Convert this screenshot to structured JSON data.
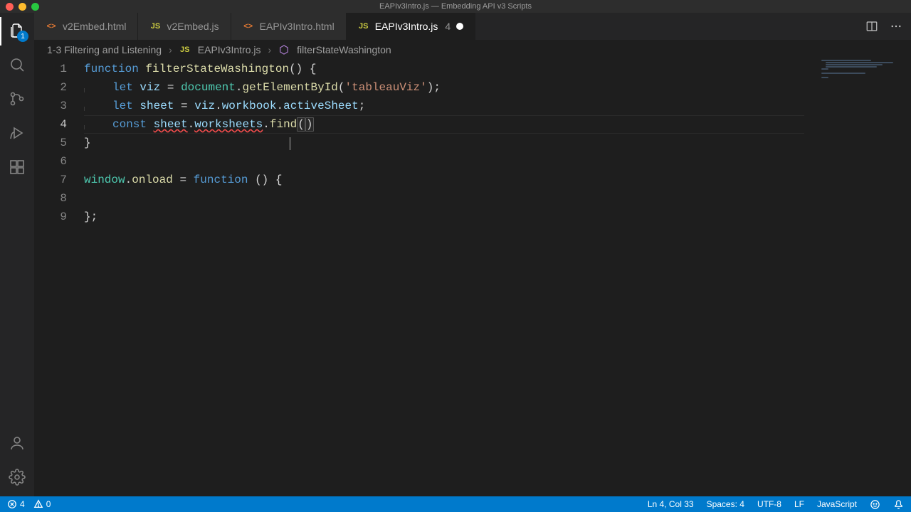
{
  "window": {
    "title": "EAPIv3Intro.js — Embedding API v3 Scripts"
  },
  "activity_bar": {
    "explorer_badge": "1"
  },
  "tabs": [
    {
      "icon_type": "html",
      "label": "v2Embed.html",
      "active": false,
      "dirty": false
    },
    {
      "icon_type": "js",
      "label": "v2Embed.js",
      "active": false,
      "dirty": false
    },
    {
      "icon_type": "html",
      "label": "EAPIv3Intro.html",
      "active": false,
      "dirty": false
    },
    {
      "icon_type": "js",
      "label": "EAPIv3Intro.js",
      "active": true,
      "dirty": true,
      "problems": "4"
    }
  ],
  "breadcrumbs": {
    "folder": "1-3 Filtering and Listening",
    "file": "EAPIv3Intro.js",
    "symbol": "filterStateWashington"
  },
  "code": {
    "line_numbers": [
      "1",
      "2",
      "3",
      "4",
      "5",
      "6",
      "7",
      "8",
      "9"
    ],
    "current_line": 4,
    "tokens": {
      "kw_function": "function",
      "fn_name": "filterStateWashington",
      "kw_let": "let",
      "kw_const": "const",
      "var_viz": "viz",
      "var_sheet": "sheet",
      "obj_document": "document",
      "m_getElementById": "getElementById",
      "str_tableauViz": "'tableauViz'",
      "prop_workbook": "workbook",
      "prop_activeSheet": "activeSheet",
      "prop_worksheets": "worksheets",
      "m_find": "find",
      "obj_window": "window",
      "prop_onload": "onload"
    }
  },
  "status": {
    "errors": "4",
    "warnings": "0",
    "cursor": "Ln 4, Col 33",
    "spaces": "Spaces: 4",
    "encoding": "UTF-8",
    "eol": "LF",
    "language": "JavaScript"
  }
}
